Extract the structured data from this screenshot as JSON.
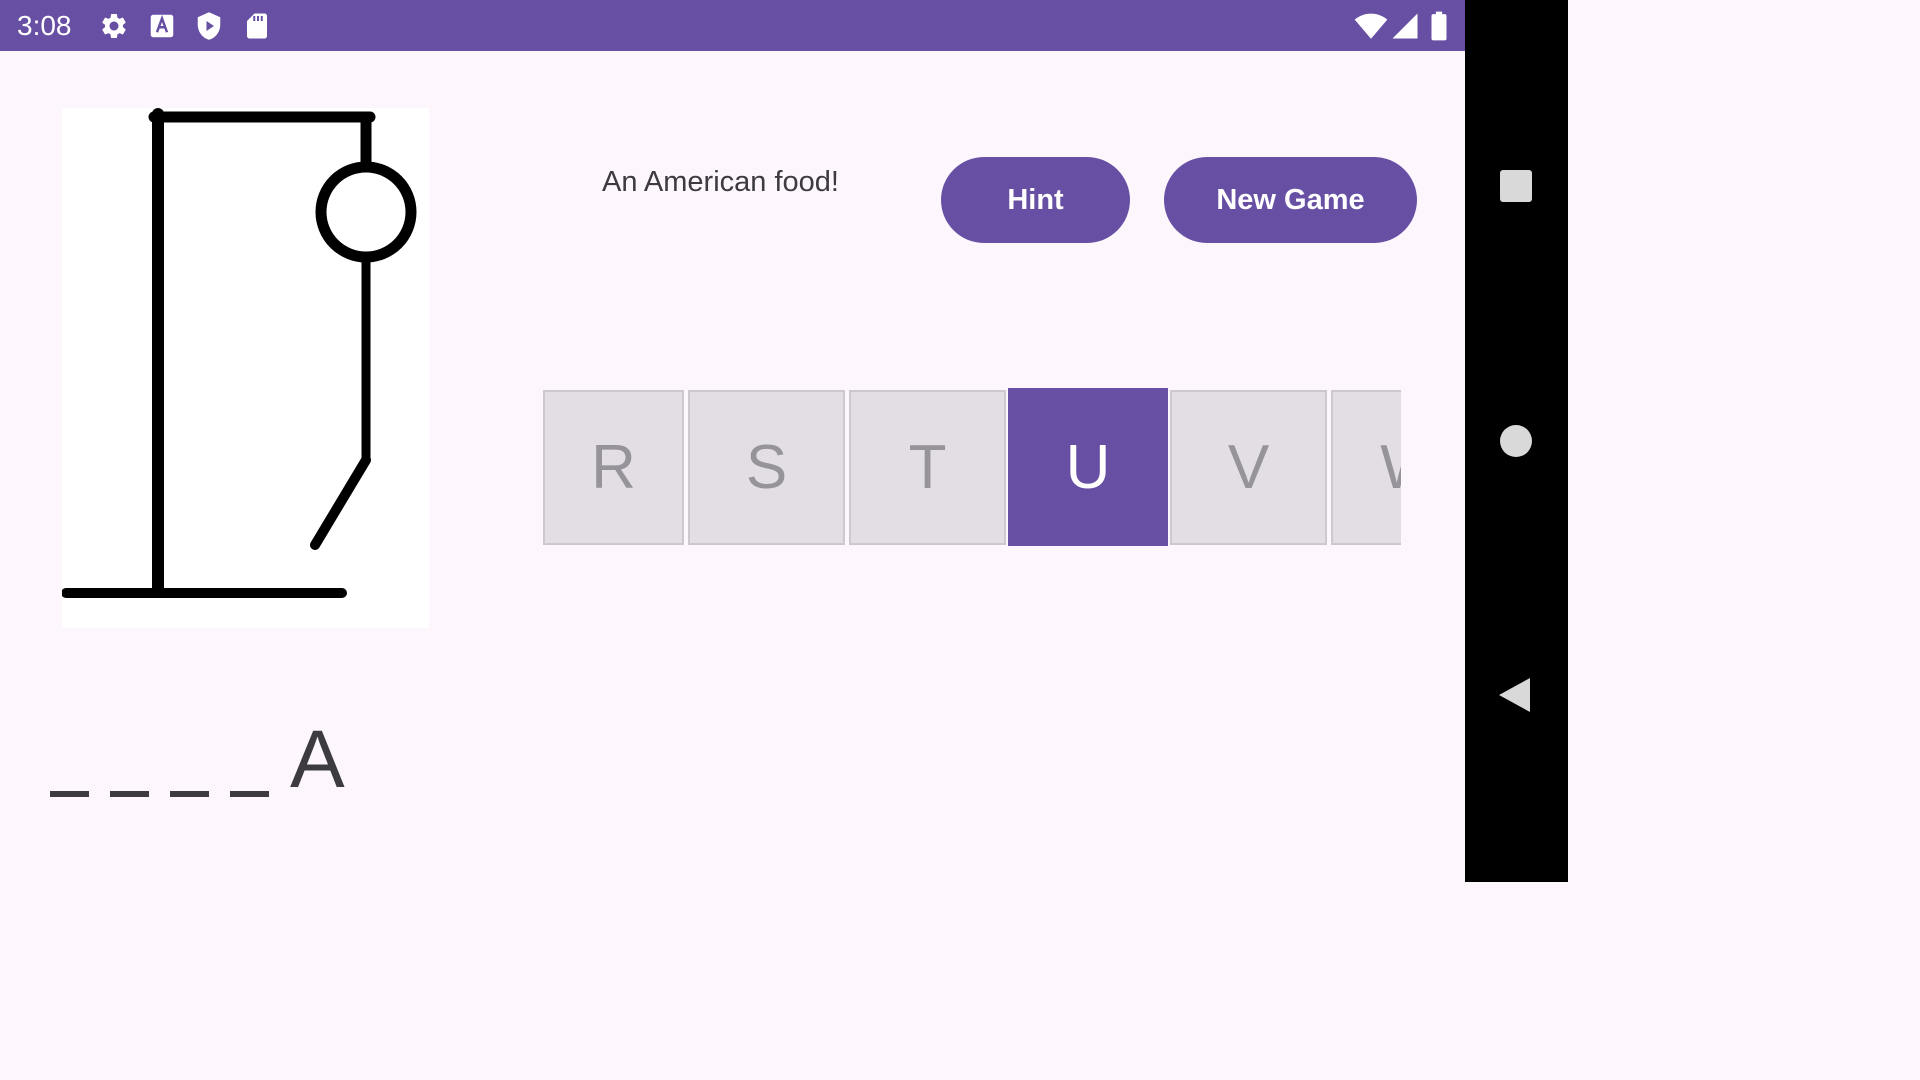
{
  "status_bar": {
    "time": "3:08",
    "left_icons": [
      "gear-icon",
      "text-a-icon",
      "play-shield-icon",
      "sd-card-icon"
    ],
    "right_icons": [
      "wifi-icon",
      "signal-icon",
      "battery-icon"
    ]
  },
  "game": {
    "hint_text": "An American food!",
    "hint_button_label": "Hint",
    "new_game_button_label": "New Game",
    "letters": [
      "R",
      "S",
      "T",
      "U",
      "V",
      "W"
    ],
    "selected_letter": "U",
    "word": [
      "_",
      "_",
      "_",
      "_",
      "A"
    ],
    "wrong_guess_parts": [
      "head",
      "body",
      "left-leg"
    ]
  },
  "nav_bar": {
    "buttons": [
      "recents-icon",
      "home-icon",
      "back-icon"
    ]
  },
  "colors": {
    "primary": "#6750a4",
    "background": "#fdf7fd",
    "key_background": "#e3dde4",
    "key_text": "#97939a",
    "text": "#3d3b40"
  }
}
